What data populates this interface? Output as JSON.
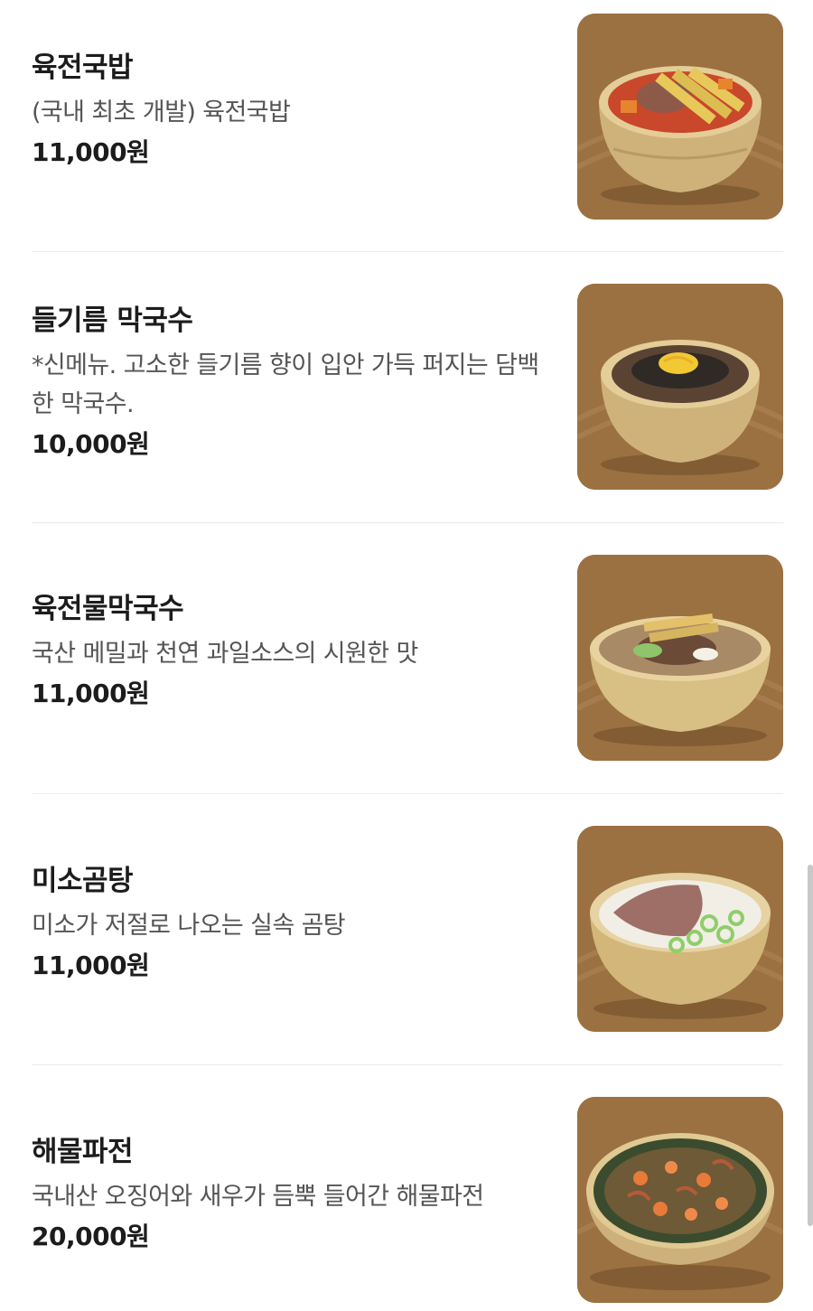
{
  "menu": [
    {
      "name": "육전국밥",
      "description": "(국내 최초 개발) 육전국밥",
      "price": "11,000원",
      "image": "bowl-soup-red-broth-meat-jeon"
    },
    {
      "name": "들기름 막국수",
      "description": "*신메뉴. 고소한 들기름 향이 입안 가득 퍼지는 담백한 막국수.",
      "price": "10,000원",
      "image": "bowl-noodles-perilla-egg"
    },
    {
      "name": "육전물막국수",
      "description": "국산 메밀과 천연 과일소스의 시원한 맛",
      "price": "11,000원",
      "image": "bowl-cold-noodles-broth-jeon"
    },
    {
      "name": "미소곰탕",
      "description": "미소가 저절로 나오는 실속 곰탕",
      "price": "11,000원",
      "image": "bowl-white-bone-soup-beef-scallion"
    },
    {
      "name": "해물파전",
      "description": "국내산 오징어와 새우가 듬뿍 들어간 해물파전",
      "price": "20,000원",
      "image": "seafood-pancake-plate"
    }
  ],
  "colors": {
    "thumb_background": "#9b7141",
    "bowl_brass": "#d8bf84",
    "divider": "#ececec"
  }
}
